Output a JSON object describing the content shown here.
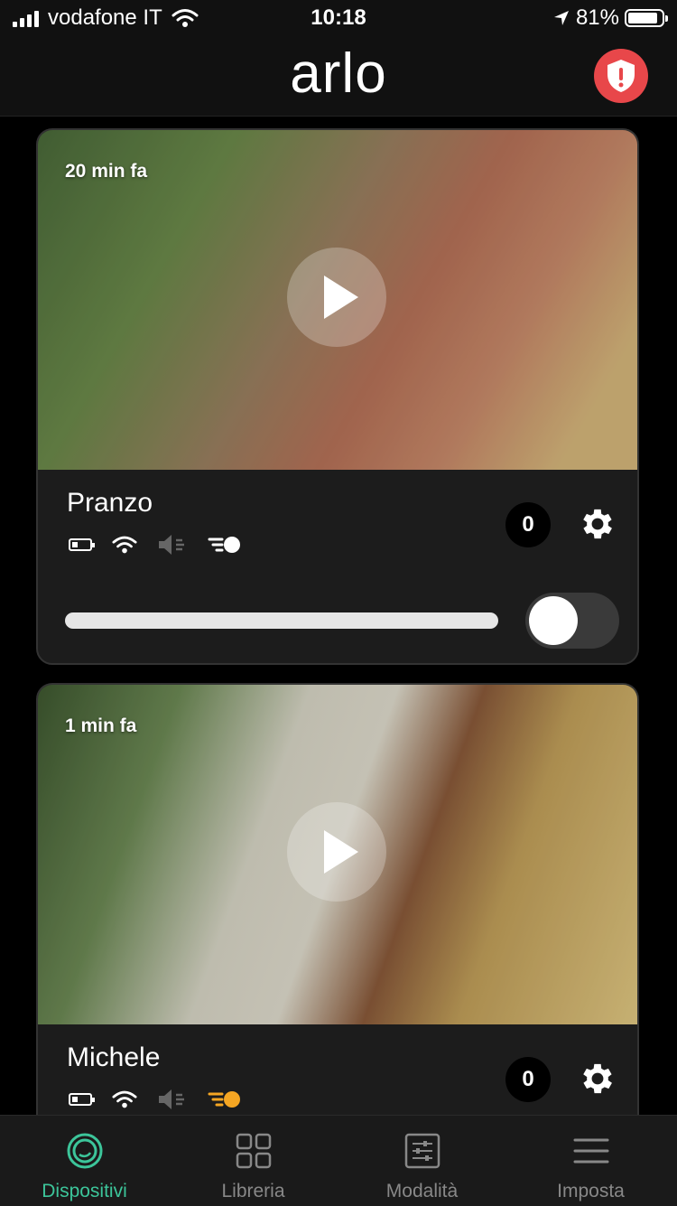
{
  "status_bar": {
    "carrier": "vodafone IT",
    "time": "10:18",
    "battery": "81%"
  },
  "header": {
    "logo": "arlo",
    "alert_icon": "shield-exclamation-icon"
  },
  "cameras": [
    {
      "timestamp": "20 min fa",
      "name": "Pranzo",
      "count": "0",
      "motion_color": "#ffffff"
    },
    {
      "timestamp": "1 min fa",
      "name": "Michele",
      "count": "0",
      "motion_color": "#f5a623"
    }
  ],
  "tabs": [
    {
      "label": "Dispositivi",
      "icon": "camera-ring-icon",
      "active": true
    },
    {
      "label": "Libreria",
      "icon": "grid-icon"
    },
    {
      "label": "Modalità",
      "icon": "sliders-icon"
    },
    {
      "label": "Imposta",
      "icon": "menu-icon"
    }
  ],
  "colors": {
    "accent": "#3cc59a",
    "alert": "#e8474a",
    "motion_active": "#f5a623"
  }
}
